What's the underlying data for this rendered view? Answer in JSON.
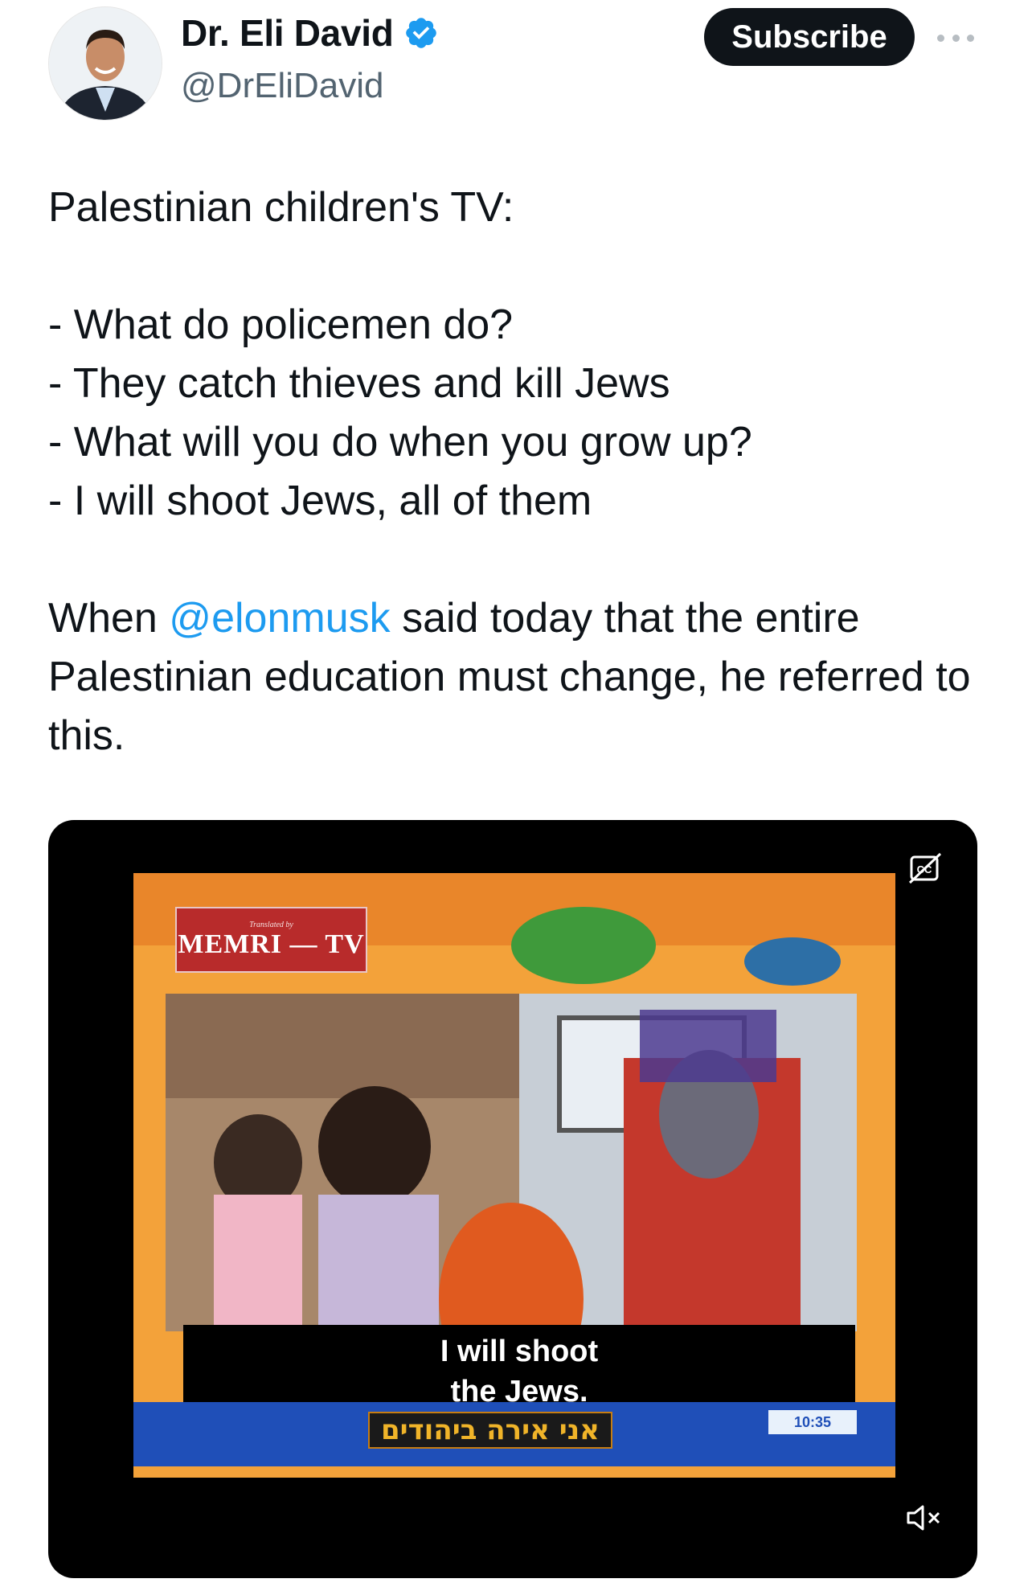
{
  "author": {
    "display_name": "Dr. Eli David",
    "handle": "@DrEliDavid",
    "verified": true
  },
  "actions": {
    "subscribe_label": "Subscribe",
    "more_icon": "more-dots-icon"
  },
  "tweet": {
    "line1": "Palestinian children's TV:",
    "dialogue": [
      "- What do policemen do?",
      "- They catch thieves and kill Jews",
      "- What will you do when you grow up?",
      "- I will shoot Jews, all of them"
    ],
    "p3_before": "When ",
    "mention": "@elonmusk",
    "p3_after": " said today that the entire Palestinian education must change, he referred to this."
  },
  "video": {
    "memri_small": "Translated by",
    "memri_label": "MEMRI — TV",
    "subtitle_line1": "I will shoot",
    "subtitle_line2": "the Jews.",
    "ticker_hebrew": "אני אירה ביהודים",
    "clock": "10:35",
    "cc_icon": "captions-icon",
    "mute_icon": "volume-muted-icon"
  },
  "colors": {
    "link": "#1d9bf0",
    "verified_badge": "#1d9bf0",
    "subscribe_bg": "#0f1419"
  }
}
